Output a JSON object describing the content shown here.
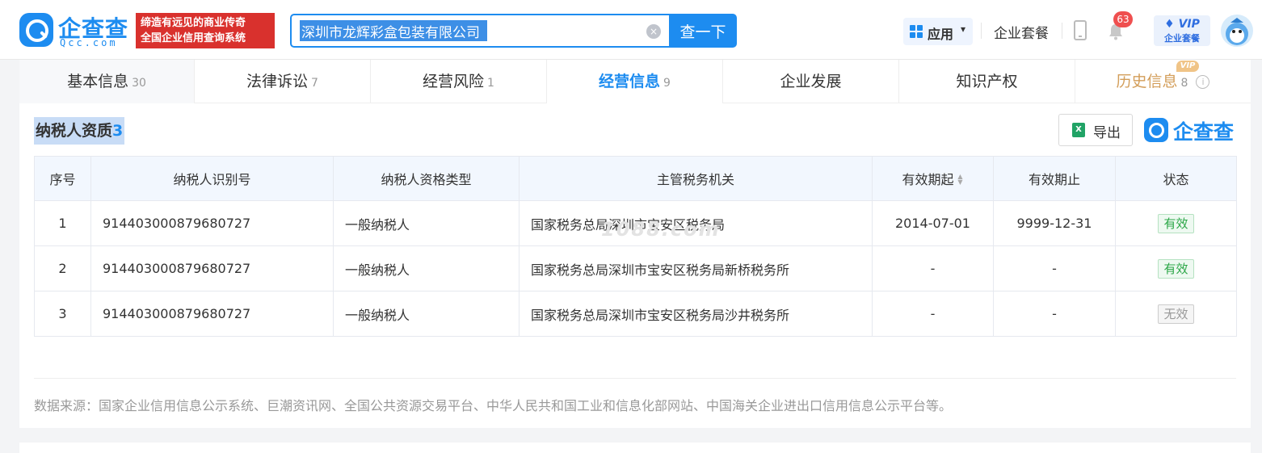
{
  "header": {
    "logo_name": "企查查",
    "logo_sub": "Qcc.com",
    "slogan_line1": "缔造有远见的商业传奇",
    "slogan_line2": "全国企业信用查询系统",
    "search_value": "深圳市龙辉彩盒包装有限公司",
    "search_button": "查一下",
    "apps_label": "应用",
    "package_link": "企业套餐",
    "notification_count": "63",
    "vip_top": "VIP",
    "vip_bottom": "企业套餐"
  },
  "tabs": [
    {
      "label": "基本信息",
      "count": "30"
    },
    {
      "label": "法律诉讼",
      "count": "7"
    },
    {
      "label": "经营风险",
      "count": "1"
    },
    {
      "label": "经营信息",
      "count": "9",
      "active": true
    },
    {
      "label": "企业发展",
      "count": ""
    },
    {
      "label": "知识产权",
      "count": ""
    },
    {
      "label": "历史信息",
      "count": "8",
      "vip_tag": "VIP"
    }
  ],
  "section": {
    "title": "纳税人资质",
    "count": "3",
    "export_label": "导出",
    "brand": "企查查",
    "watermark": "1088.com"
  },
  "table": {
    "columns": [
      "序号",
      "纳税人识别号",
      "纳税人资格类型",
      "主管税务机关",
      "有效期起",
      "有效期止",
      "状态"
    ],
    "rows": [
      [
        "1",
        "914403000879680727",
        "一般纳税人",
        "国家税务总局深圳市宝安区税务局",
        "2014-07-01",
        "9999-12-31",
        "有效"
      ],
      [
        "2",
        "914403000879680727",
        "一般纳税人",
        "国家税务总局深圳市宝安区税务局新桥税务所",
        "-",
        "-",
        "有效"
      ],
      [
        "3",
        "914403000879680727",
        "一般纳税人",
        "国家税务总局深圳市宝安区税务局沙井税务所",
        "-",
        "-",
        "无效"
      ]
    ]
  },
  "source_text": "数据来源：国家企业信用信息公示系统、巨潮资讯网、全国公共资源交易平台、中华人民共和国工业和信息化部网站、中国海关企业进出口信用信息公示平台等。",
  "colors": {
    "brand_blue": "#1d8cf0",
    "slogan_red": "#d9312d",
    "valid_green": "#2aa646",
    "history_gold": "#d39e5a"
  }
}
